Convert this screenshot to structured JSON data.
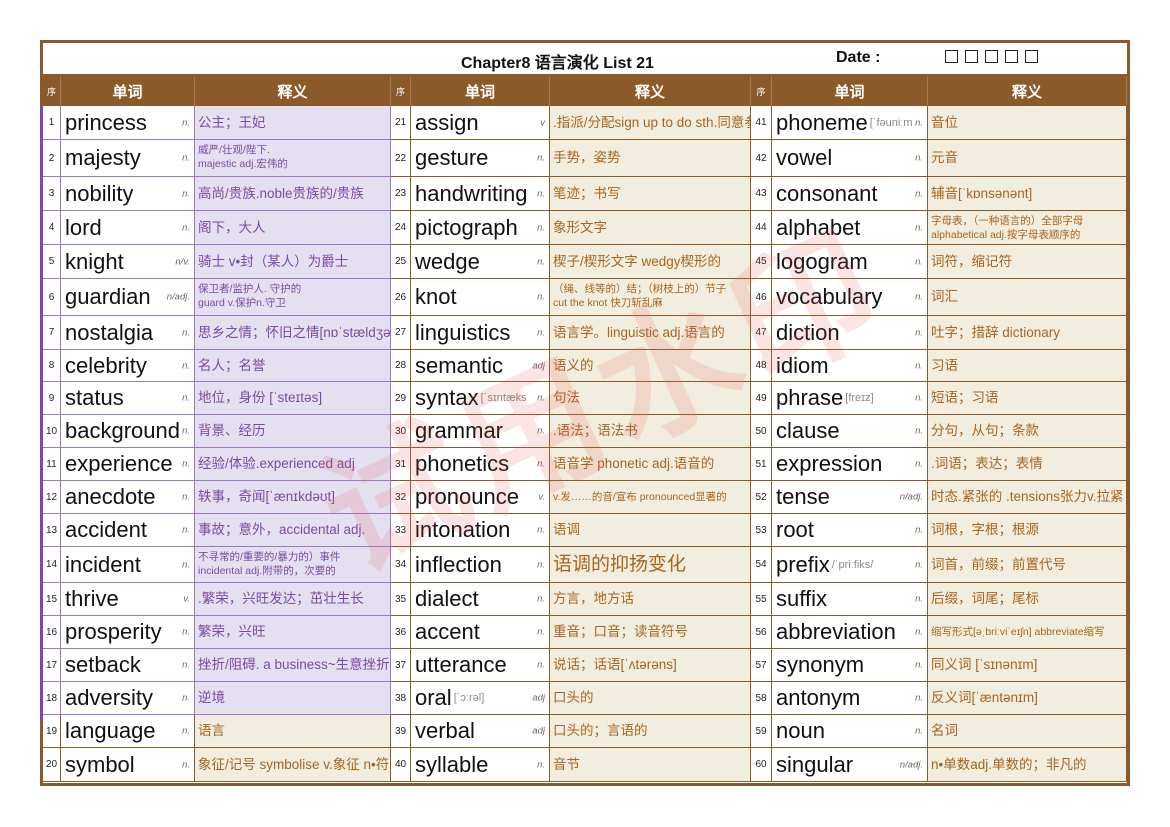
{
  "header": {
    "title": "Chapter8 语言演化 List 21",
    "date_label": "Date :",
    "date_box_count": 5
  },
  "columns": {
    "seq": "序",
    "word": "单词",
    "definition": "释义"
  },
  "colors": {
    "brown": "#8b5a2b",
    "purple_text": "#7b4aa5",
    "purple_bg": "#e4e0ef",
    "brown_text": "#a8641e",
    "cream_bg": "#f2eedf"
  },
  "watermark": "试用水印",
  "entries": [
    {
      "n": "1",
      "word": "princess",
      "phon": "",
      "pos": "n.",
      "def": "公主；王妃",
      "style": ""
    },
    {
      "n": "2",
      "word": "majesty",
      "phon": "",
      "pos": "n.",
      "def": "威严/壮观/陛下.\nmajestic adj.宏伟的",
      "style": "small"
    },
    {
      "n": "3",
      "word": "nobility",
      "phon": "",
      "pos": "n.",
      "def": "高尚/贵族.noble贵族的/贵族",
      "style": ""
    },
    {
      "n": "4",
      "word": "lord",
      "phon": "",
      "pos": "n.",
      "def": "阁下，大人",
      "style": ""
    },
    {
      "n": "5",
      "word": "knight",
      "phon": "",
      "pos": "n/v.",
      "def": "骑士 v•封（某人）为爵士",
      "style": ""
    },
    {
      "n": "6",
      "word": "guardian",
      "phon": "",
      "pos": "n/adj.",
      "def": "保卫者/监护人. 守护的\nguard v.保护n.守卫",
      "style": "small"
    },
    {
      "n": "7",
      "word": "nostalgia",
      "phon": "",
      "pos": "n.",
      "def": "思乡之情；怀旧之情[nɒˈstældʒə]",
      "style": ""
    },
    {
      "n": "8",
      "word": "celebrity",
      "phon": "",
      "pos": "n.",
      "def": "名人；名誉",
      "style": ""
    },
    {
      "n": "9",
      "word": "status",
      "phon": "",
      "pos": "n.",
      "def": "地位，身份 [ˈsteɪtəs]",
      "style": ""
    },
    {
      "n": "10",
      "word": "background",
      "phon": "",
      "pos": "n.",
      "def": "背景、经历",
      "style": ""
    },
    {
      "n": "11",
      "word": "experience",
      "phon": "",
      "pos": "n.",
      "def": "经验/体验.experienced adj",
      "style": ""
    },
    {
      "n": "12",
      "word": "anecdote",
      "phon": "",
      "pos": "n.",
      "def": "轶事，奇闻[ˈænɪkdəʊt]",
      "style": ""
    },
    {
      "n": "13",
      "word": "accident",
      "phon": "",
      "pos": "n.",
      "def": "事故；意外，accidental adj.",
      "style": ""
    },
    {
      "n": "14",
      "word": "incident",
      "phon": "",
      "pos": "n.",
      "def": "不寻常的/重要的/暴力的）事件\nincidental adj.附带的，次要的",
      "style": "small"
    },
    {
      "n": "15",
      "word": "thrive",
      "phon": "",
      "pos": "v.",
      "def": ".繁荣，兴旺发达；茁壮生长",
      "style": ""
    },
    {
      "n": "16",
      "word": "prosperity",
      "phon": "",
      "pos": "n.",
      "def": "繁荣，兴旺",
      "style": ""
    },
    {
      "n": "17",
      "word": "setback",
      "phon": "",
      "pos": "n.",
      "def": "挫折/阻碍. a business~生意挫折",
      "style": ""
    },
    {
      "n": "18",
      "word": "adversity",
      "phon": "",
      "pos": "n.",
      "def": "逆境",
      "style": ""
    },
    {
      "n": "19",
      "word": "language",
      "phon": "",
      "pos": "n.",
      "def": "语言",
      "style": ""
    },
    {
      "n": "20",
      "word": "symbol",
      "phon": "",
      "pos": "n.",
      "def": "象征/记号 symbolise v.象征 n•符号",
      "style": ""
    },
    {
      "n": "21",
      "word": "assign",
      "phon": "",
      "pos": "v",
      "def": ".指派/分配sign up to do sth.同意参事",
      "style": ""
    },
    {
      "n": "22",
      "word": "gesture",
      "phon": "",
      "pos": "n.",
      "def": "手势，姿势",
      "style": ""
    },
    {
      "n": "23",
      "word": "handwriting",
      "phon": "",
      "pos": "n.",
      "def": "笔迹；书写",
      "style": ""
    },
    {
      "n": "24",
      "word": "pictograph",
      "phon": "",
      "pos": "n.",
      "def": "象形文字",
      "style": ""
    },
    {
      "n": "25",
      "word": "wedge",
      "phon": "",
      "pos": "n.",
      "def": "楔子/楔形文字 wedgy楔形的",
      "style": ""
    },
    {
      "n": "26",
      "word": "knot",
      "phon": "",
      "pos": "n.",
      "def": "（绳、线等的）结；（树枝上的）节子\ncut the knot 快刀斩乱麻",
      "style": "small"
    },
    {
      "n": "27",
      "word": "linguistics",
      "phon": "",
      "pos": "n.",
      "def": "语言学。linguistic adj.语言的",
      "style": ""
    },
    {
      "n": "28",
      "word": "semantic",
      "phon": "",
      "pos": "adj",
      "def": "语义的",
      "style": ""
    },
    {
      "n": "29",
      "word": "syntax",
      "phon": "[ˈsɪntæks",
      "pos": "n.",
      "def": "句法",
      "style": ""
    },
    {
      "n": "30",
      "word": "grammar",
      "phon": "",
      "pos": "n.",
      "def": ".语法；语法书",
      "style": ""
    },
    {
      "n": "31",
      "word": "phonetics",
      "phon": "",
      "pos": "n.",
      "def": "语音学 phonetic adj.语音的",
      "style": ""
    },
    {
      "n": "32",
      "word": "pronounce",
      "phon": "",
      "pos": "v.",
      "def": "v.发……的音/宣布  pronounced显著的",
      "style": "tiny"
    },
    {
      "n": "33",
      "word": "intonation",
      "phon": "",
      "pos": "n.",
      "def": "语调",
      "style": ""
    },
    {
      "n": "34",
      "word": "inflection",
      "phon": "",
      "pos": "n.",
      "def": "语调的抑扬变化",
      "style": "large"
    },
    {
      "n": "35",
      "word": "dialect",
      "phon": "",
      "pos": "n.",
      "def": "方言，地方话",
      "style": ""
    },
    {
      "n": "36",
      "word": "accent",
      "phon": "",
      "pos": "n.",
      "def": "重音；口音；读音符号",
      "style": ""
    },
    {
      "n": "37",
      "word": "utterance",
      "phon": "",
      "pos": "n.",
      "def": "说话；话语[ˈʌtərəns]",
      "style": ""
    },
    {
      "n": "38",
      "word": "oral",
      "phon": "[ˈɔːrəl]",
      "pos": "adj",
      "def": "口头的",
      "style": ""
    },
    {
      "n": "39",
      "word": "verbal",
      "phon": "",
      "pos": "adj",
      "def": "口头的；言语的",
      "style": ""
    },
    {
      "n": "40",
      "word": "syllable",
      "phon": "",
      "pos": "n.",
      "def": "音节",
      "style": ""
    },
    {
      "n": "41",
      "word": "phoneme",
      "phon": "[ˈfəuniːm",
      "pos": "n.",
      "def": "音位",
      "style": ""
    },
    {
      "n": "42",
      "word": "vowel",
      "phon": "",
      "pos": "n.",
      "def": "元音",
      "style": ""
    },
    {
      "n": "43",
      "word": "consonant",
      "phon": "",
      "pos": "n.",
      "def": "辅音[ˈkɒnsənənt]",
      "style": ""
    },
    {
      "n": "44",
      "word": "alphabet",
      "phon": "",
      "pos": "n.",
      "def": "字母表，（一种语言的）全部字母\nalphabetical adj.按字母表顺序的",
      "style": "small"
    },
    {
      "n": "45",
      "word": "logogram",
      "phon": "",
      "pos": "n.",
      "def": "词符，缩记符",
      "style": ""
    },
    {
      "n": "46",
      "word": "vocabulary",
      "phon": "",
      "pos": "n.",
      "def": "词汇",
      "style": ""
    },
    {
      "n": "47",
      "word": "diction",
      "phon": "",
      "pos": "n.",
      "def": "吐字；措辞 dictionary",
      "style": ""
    },
    {
      "n": "48",
      "word": "idiom",
      "phon": "",
      "pos": "n.",
      "def": "习语",
      "style": ""
    },
    {
      "n": "49",
      "word": "phrase",
      "phon": "[freɪz]",
      "pos": "n.",
      "def": "短语；习语",
      "style": ""
    },
    {
      "n": "50",
      "word": "clause",
      "phon": "",
      "pos": "n.",
      "def": "分句，从句；条款",
      "style": ""
    },
    {
      "n": "51",
      "word": "expression",
      "phon": "",
      "pos": "n.",
      "def": ".词语；表达；表情",
      "style": ""
    },
    {
      "n": "52",
      "word": "tense",
      "phon": "",
      "pos": "n/adj.",
      "def": "时态.紧张的 .tensions张力v.拉紧",
      "style": ""
    },
    {
      "n": "53",
      "word": "root",
      "phon": "",
      "pos": "n.",
      "def": "词根，字根；根源",
      "style": ""
    },
    {
      "n": "54",
      "word": "prefix",
      "phon": " /ˈpriːfiks/",
      "pos": "n.",
      "def": "词首，前缀；前置代号",
      "style": ""
    },
    {
      "n": "55",
      "word": "suffix",
      "phon": "",
      "pos": "n.",
      "def": "后缀，词尾；尾标",
      "style": ""
    },
    {
      "n": "56",
      "word": "abbreviation",
      "phon": "",
      "pos": "n.",
      "def": "缩写形式[əˌbriːviˈeɪʃn] abbreviate缩写",
      "style": "tiny"
    },
    {
      "n": "57",
      "word": "synonym",
      "phon": "",
      "pos": "n.",
      "def": "同义词 [ˈsɪnənɪm]",
      "style": ""
    },
    {
      "n": "58",
      "word": "antonym",
      "phon": "",
      "pos": "n.",
      "def": "反义词[ˈæntənɪm]",
      "style": ""
    },
    {
      "n": "59",
      "word": "noun",
      "phon": "",
      "pos": "n.",
      "def": "名词",
      "style": ""
    },
    {
      "n": "60",
      "word": "singular",
      "phon": "",
      "pos": "n/adj.",
      "def": "n•单数adj.单数的；非凡的",
      "style": ""
    }
  ]
}
